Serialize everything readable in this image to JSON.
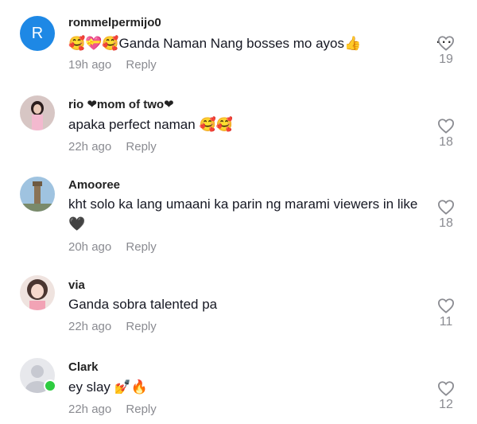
{
  "comments": [
    {
      "username": "rommelpermijo0",
      "avatar_letter": "R",
      "text_emoji_prefix": "🥰💝🥰",
      "text": "Ganda Naman Nang bosses mo ayos",
      "text_emoji_suffix": "👍",
      "time": "19h ago",
      "reply_label": "Reply",
      "likes": "19"
    },
    {
      "username": "rio ❤mom of two❤",
      "avatar_letter": "",
      "text": "apaka perfect naman 🥰🥰",
      "time": "22h ago",
      "reply_label": "Reply",
      "likes": "18"
    },
    {
      "username": "Amooree",
      "avatar_letter": "",
      "text": "kht solo ka lang umaani ka parin ng marami viewers in like🖤",
      "time": "20h ago",
      "reply_label": "Reply",
      "likes": "18"
    },
    {
      "username": "via",
      "avatar_letter": "",
      "text": "Ganda sobra talented pa",
      "time": "22h ago",
      "reply_label": "Reply",
      "likes": "11"
    },
    {
      "username": "Clark",
      "avatar_letter": "",
      "text": "ey slay 💅🔥",
      "time": "22h ago",
      "reply_label": "Reply",
      "likes": "12"
    }
  ],
  "more_icon": "more-horizontal-icon",
  "colors": {
    "secondary_text": "#8a8b91",
    "avatar_blue": "#1e88e5",
    "online_green": "#2ecc40"
  }
}
